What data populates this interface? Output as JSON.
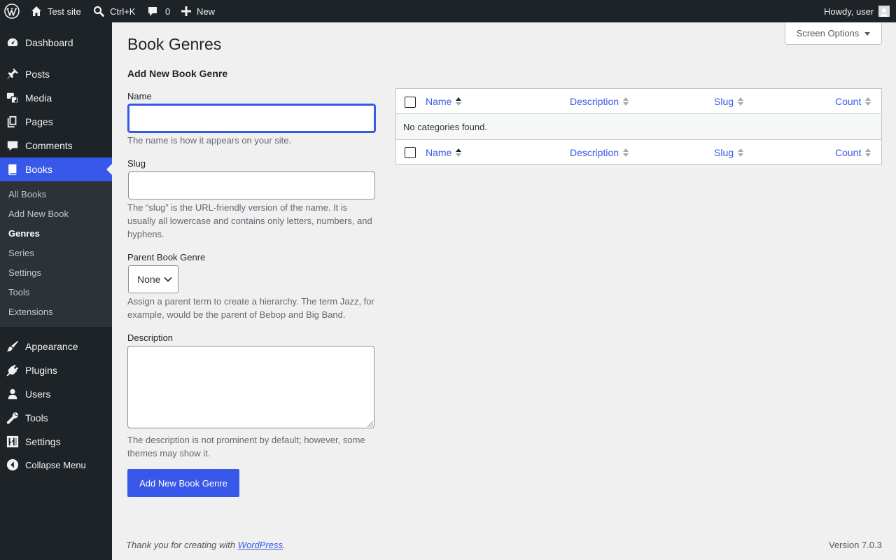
{
  "adminbar": {
    "site_name": "Test site",
    "search_shortcut": "Ctrl+K",
    "comments_count": "0",
    "new_label": "New",
    "howdy": "Howdy, user"
  },
  "sidebar": {
    "items": [
      {
        "label": "Dashboard",
        "icon": "dashboard-icon"
      },
      {
        "label": "Posts",
        "icon": "pushpin-icon"
      },
      {
        "label": "Media",
        "icon": "media-icon"
      },
      {
        "label": "Pages",
        "icon": "pages-icon"
      },
      {
        "label": "Comments",
        "icon": "comment-icon"
      },
      {
        "label": "Books",
        "icon": "book-icon"
      },
      {
        "label": "Appearance",
        "icon": "brush-icon"
      },
      {
        "label": "Plugins",
        "icon": "plug-icon"
      },
      {
        "label": "Users",
        "icon": "user-icon"
      },
      {
        "label": "Tools",
        "icon": "wrench-icon"
      },
      {
        "label": "Settings",
        "icon": "sliders-icon"
      }
    ],
    "submenu": [
      "All Books",
      "Add New Book",
      "Genres",
      "Series",
      "Settings",
      "Tools",
      "Extensions"
    ],
    "collapse_label": "Collapse Menu"
  },
  "screen_options": "Screen Options",
  "page": {
    "title": "Book Genres",
    "form_title": "Add New Book Genre",
    "name_label": "Name",
    "name_value": "",
    "name_desc": "The name is how it appears on your site.",
    "slug_label": "Slug",
    "slug_value": "",
    "slug_desc": "The “slug” is the URL-friendly version of the name. It is usually all lowercase and contains only letters, numbers, and hyphens.",
    "parent_label": "Parent Book Genre",
    "parent_value": "None",
    "parent_desc": "Assign a parent term to create a hierarchy. The term Jazz, for example, would be the parent of Bebop and Big Band.",
    "description_label": "Description",
    "description_value": "",
    "description_desc": "The description is not prominent by default; however, some themes may show it.",
    "submit_label": "Add New Book Genre"
  },
  "table": {
    "columns": [
      "Name",
      "Description",
      "Slug",
      "Count"
    ],
    "empty_message": "No categories found."
  },
  "footer": {
    "thanks_prefix": "Thank you for creating with ",
    "thanks_link": "WordPress",
    "thanks_suffix": ".",
    "version": "Version 7.0.3"
  },
  "colors": {
    "accent": "#3858e9",
    "adminbar_bg": "#1d2327",
    "submenu_bg": "#2c3338",
    "page_bg": "#f0f0f1"
  }
}
